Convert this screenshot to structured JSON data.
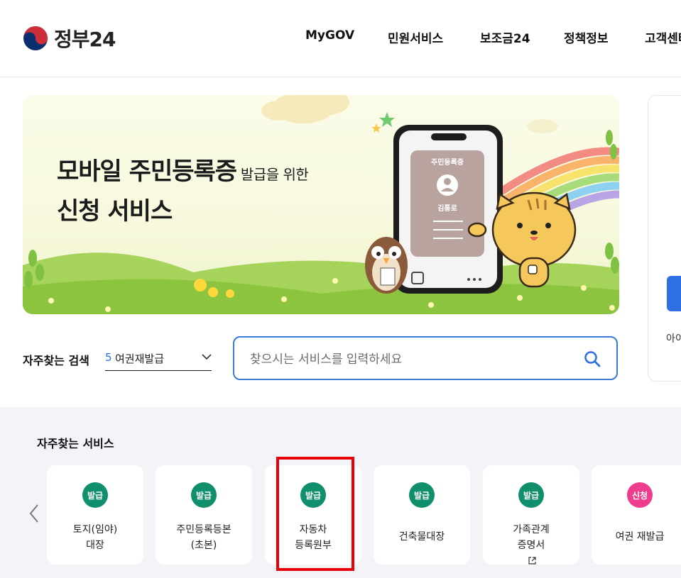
{
  "header": {
    "logo_text": "정부24",
    "nav": [
      "MyGOV",
      "민원서비스",
      "보조금24",
      "정책정보",
      "고객센터"
    ]
  },
  "banner": {
    "title_bold_1": "모바일 주민등록증",
    "title_small": " 발급을 위한",
    "title_bold_2": "신청 서비스",
    "card_title": "주민등록증",
    "card_name": "김통로"
  },
  "side_card": {
    "text": "아이"
  },
  "frequent_search": {
    "label": "자주찾는 검색",
    "rank": "5",
    "keyword": "여권재발급",
    "search_placeholder": "찾으시는 서비스를 입력하세요"
  },
  "services": {
    "title": "자주찾는 서비스",
    "items": [
      {
        "badge": "발급",
        "line1": "토지(임야)",
        "line2": "대장"
      },
      {
        "badge": "발급",
        "line1": "주민등록등본",
        "line2": "(초본)"
      },
      {
        "badge": "발급",
        "line1": "자동차",
        "line2": "등록원부"
      },
      {
        "badge": "발급",
        "line1": "건축물대장",
        "line2": ""
      },
      {
        "badge": "발급",
        "line1": "가족관계",
        "line2": "증명서"
      },
      {
        "badge": "신청",
        "line1": "여권 재발급",
        "line2": ""
      }
    ]
  },
  "colors": {
    "accent": "#2f6fe4",
    "badge_green": "#0f8f6b",
    "badge_pink": "#ee3d8c",
    "highlight": "#e8000b"
  }
}
